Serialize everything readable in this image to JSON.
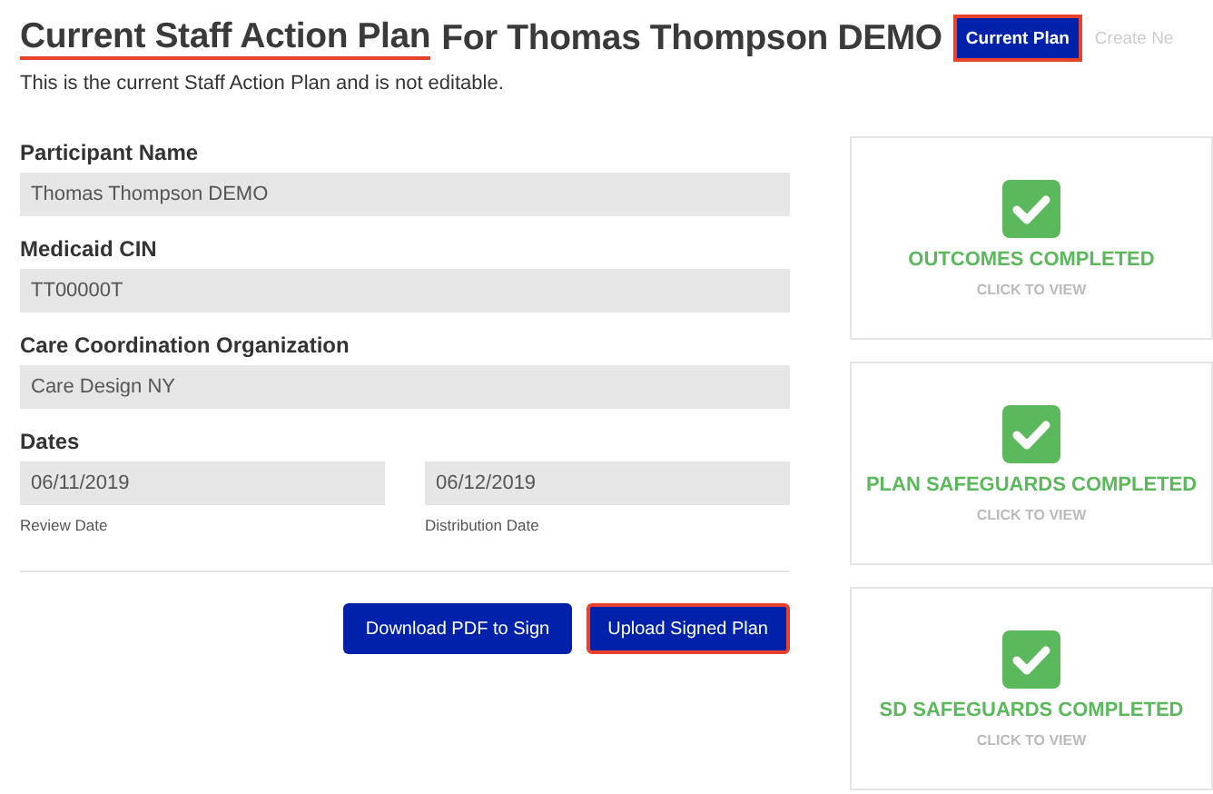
{
  "header": {
    "title_underlined": "Current Staff Action Plan",
    "title_rest": "For Thomas Thompson DEMO",
    "subtitle": "This is the current Staff Action Plan and is not editable."
  },
  "tabs": [
    {
      "label": "Current Plan",
      "selected": true,
      "highlighted": true
    },
    {
      "label": "Create Ne",
      "selected": false,
      "highlighted": false
    }
  ],
  "fields": [
    {
      "label": "Participant Name",
      "value": "Thomas Thompson DEMO"
    },
    {
      "label": "Medicaid CIN",
      "value": "TT00000T"
    },
    {
      "label": "Care Coordination Organization",
      "value": "Care Design NY"
    }
  ],
  "dates": {
    "label": "Dates",
    "items": [
      {
        "value": "06/11/2019",
        "caption": "Review Date"
      },
      {
        "value": "06/12/2019",
        "caption": "Distribution Date"
      }
    ]
  },
  "buttons": [
    {
      "label": "Download PDF to Sign",
      "highlighted": false
    },
    {
      "label": "Upload Signed Plan",
      "highlighted": true
    }
  ],
  "cards": [
    {
      "title": "OUTCOMES COMPLETED",
      "action": "CLICK TO VIEW",
      "completed": true
    },
    {
      "title": "PLAN SAFEGUARDS COMPLETED",
      "action": "CLICK TO VIEW",
      "completed": true
    },
    {
      "title": "SD SAFEGUARDS COMPLETED",
      "action": "CLICK TO VIEW",
      "completed": true
    }
  ]
}
